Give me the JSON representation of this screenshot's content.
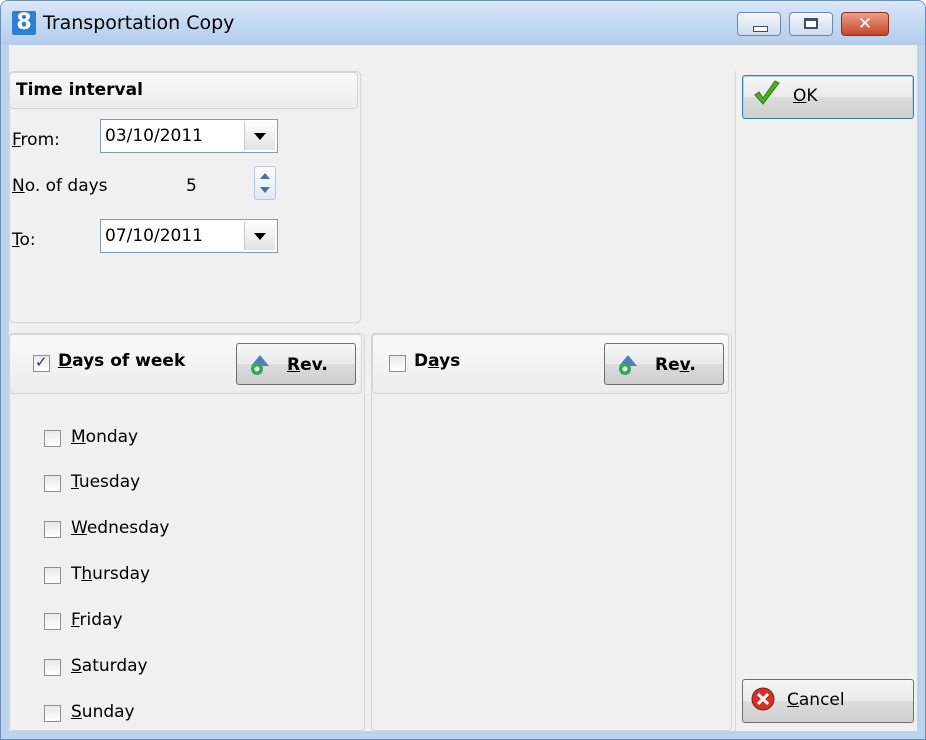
{
  "window": {
    "title": "Transportation Copy",
    "app_icon_glyph": "8"
  },
  "time_interval": {
    "header": "Time interval",
    "from_label": "From:",
    "from_value": "03/10/2011",
    "days_label": "No. of days",
    "days_value": "5",
    "to_label": "To:",
    "to_value": "07/10/2011"
  },
  "days_of_week": {
    "header": "Days of week",
    "checked": true,
    "rev_label": "Rev.",
    "items": [
      "Monday",
      "Tuesday",
      "Wednesday",
      "Thursday",
      "Friday",
      "Saturday",
      "Sunday"
    ]
  },
  "days": {
    "header": "Days",
    "checked": false,
    "rev_label": "Rev."
  },
  "buttons": {
    "ok": "OK",
    "cancel": "Cancel"
  },
  "colors": {
    "title_bar": "#c6daf2",
    "client": "#f0f0f0",
    "ok_check": "#4caf1e",
    "cancel_red": "#d3302a"
  }
}
